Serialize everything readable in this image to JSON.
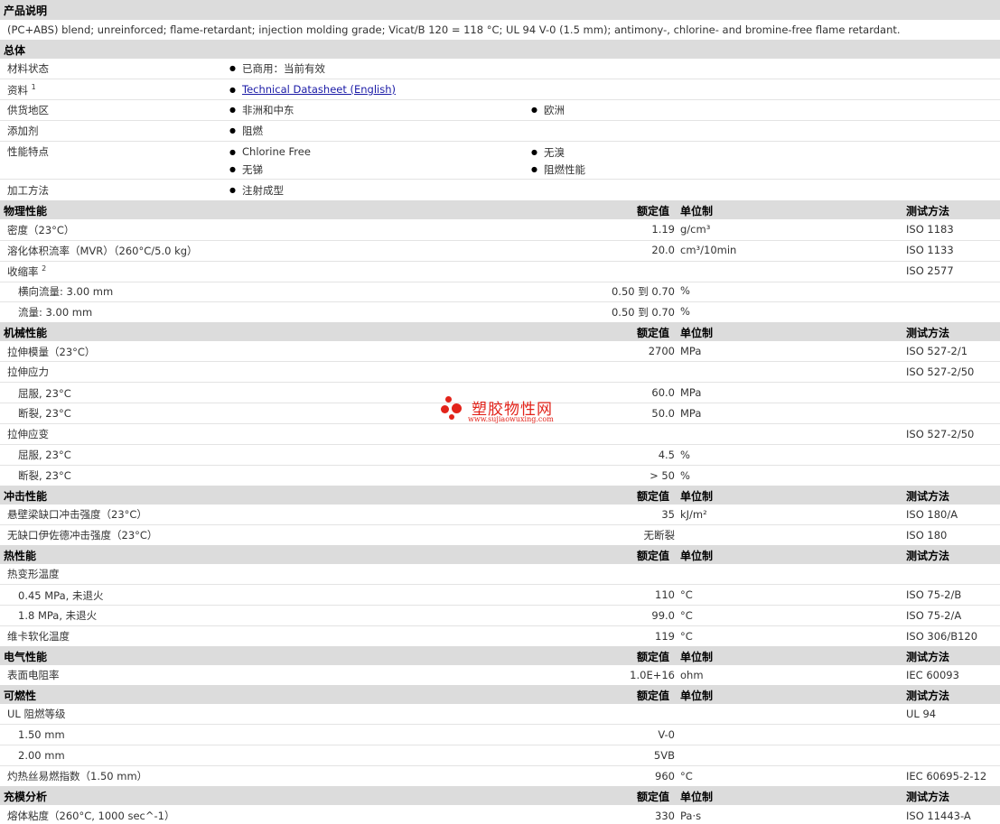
{
  "desc": {
    "title": "产品说明",
    "text": "(PC+ABS) blend; unreinforced; flame-retardant; injection molding grade; Vicat/B 120 = 118 °C; UL 94 V-0 (1.5 mm); antimony-, chlorine- and bromine-free flame retardant."
  },
  "general": {
    "title": "总体",
    "status_label": "材料状态",
    "status_value": "已商用：当前有效",
    "docs_label": "资料",
    "docs_sup": "1",
    "docs_link": "Technical Datasheet (English)",
    "region_label": "供货地区",
    "region_1": "非洲和中东",
    "region_2": "欧洲",
    "additive_label": "添加剂",
    "additive_value": "阻燃",
    "features_label": "性能特点",
    "feature_1": "Chlorine Free",
    "feature_2": "无溴",
    "feature_3": "无锑",
    "feature_4": "阻燃性能",
    "process_label": "加工方法",
    "process_value": "注射成型"
  },
  "headers": {
    "value": "额定值",
    "unit": "单位制",
    "method": "测试方法"
  },
  "physical": {
    "title": "物理性能",
    "density_label": "密度（23°C）",
    "density_value": "1.19",
    "density_unit": "g/cm³",
    "density_method": "ISO 1183",
    "mvr_label": "溶化体积流率（MVR）（260°C/5.0 kg）",
    "mvr_value": "20.0",
    "mvr_unit": "cm³/10min",
    "mvr_method": "ISO 1133",
    "shrink_label": "收缩率",
    "shrink_sup": "2",
    "shrink_method": "ISO 2577",
    "shrink_trans_label": "横向流量: 3.00 mm",
    "shrink_trans_value": "0.50 到  0.70",
    "shrink_trans_unit": "%",
    "shrink_flow_label": "流量: 3.00 mm",
    "shrink_flow_value": "0.50 到  0.70",
    "shrink_flow_unit": "%"
  },
  "mechanical": {
    "title": "机械性能",
    "modulus_label": "拉伸模量（23°C）",
    "modulus_value": "2700",
    "modulus_unit": "MPa",
    "modulus_method": "ISO 527-2/1",
    "stress_label": "拉伸应力",
    "stress_method": "ISO 527-2/50",
    "stress_yield_label": "屈服, 23°C",
    "stress_yield_value": "60.0",
    "stress_yield_unit": "MPa",
    "stress_break_label": "断裂, 23°C",
    "stress_break_value": "50.0",
    "stress_break_unit": "MPa",
    "strain_label": "拉伸应变",
    "strain_method": "ISO 527-2/50",
    "strain_yield_label": "屈服, 23°C",
    "strain_yield_value": "4.5",
    "strain_yield_unit": "%",
    "strain_break_label": "断裂, 23°C",
    "strain_break_value": "> 50",
    "strain_break_unit": "%"
  },
  "impact": {
    "title": "冲击性能",
    "izod_label": "悬壁梁缺口冲击强度（23°C）",
    "izod_value": "35",
    "izod_unit": "kJ/m²",
    "izod_method": "ISO 180/A",
    "unnotched_label": "无缺口伊佐德冲击强度（23°C）",
    "unnotched_value": "无断裂",
    "unnotched_method": "ISO 180"
  },
  "thermal": {
    "title": "热性能",
    "hdt_label": "热变形温度",
    "hdt1_label": "0.45 MPa, 未退火",
    "hdt1_value": "110",
    "hdt1_unit": "°C",
    "hdt1_method": "ISO 75-2/B",
    "hdt2_label": "1.8 MPa, 未退火",
    "hdt2_value": "99.0",
    "hdt2_unit": "°C",
    "hdt2_method": "ISO 75-2/A",
    "vicat_label": "维卡软化温度",
    "vicat_value": "119",
    "vicat_unit": "°C",
    "vicat_method": "ISO 306/B120"
  },
  "electrical": {
    "title": "电气性能",
    "surf_label": "表面电阻率",
    "surf_value": "1.0E+16",
    "surf_unit": "ohm",
    "surf_method": "IEC 60093"
  },
  "flammability": {
    "title": "可燃性",
    "ul_label": "UL 阻燃等级",
    "ul_method": "UL 94",
    "ul1_label": "1.50 mm",
    "ul1_value": "V-0",
    "ul2_label": "2.00 mm",
    "ul2_value": "5VB",
    "gwfi_label": "灼热丝易燃指数（1.50 mm）",
    "gwfi_value": "960",
    "gwfi_unit": "°C",
    "gwfi_method": "IEC 60695-2-12"
  },
  "injection": {
    "title": "充模分析",
    "visc_label": "熔体粘度（260°C, 1000 sec^-1）",
    "visc_value": "330",
    "visc_unit": "Pa·s",
    "visc_method": "ISO 11443-A"
  },
  "watermark": {
    "text": "塑胶物性网",
    "url": "www.sujiaowuxing.com",
    "color": "#e2231a"
  }
}
